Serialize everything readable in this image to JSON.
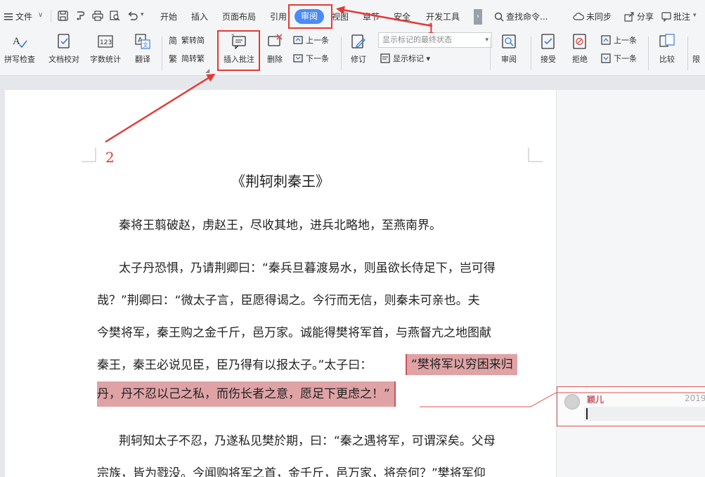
{
  "menubar": {
    "file_label": "文件",
    "tabs": [
      "开始",
      "插入",
      "页面布局",
      "引用",
      "审阅",
      "视图",
      "章节",
      "安全",
      "开发工具"
    ],
    "active_tab": "审阅",
    "search": "查找命令...",
    "sync": "未同步",
    "share": "分享",
    "comment": "批注"
  },
  "ribbon": {
    "spell_check": "拼写检查",
    "proofread": "文档校对",
    "word_count": "字数统计",
    "translate": "翻译",
    "trad_to_simp": "繁转简",
    "simp_to_trad": "简转繁",
    "insert_comment": "插入批注",
    "delete": "删除",
    "prev_comment": "上一条",
    "next_comment": "下一条",
    "revise": "修订",
    "markup_state": "显示标记的最终状态",
    "show_markup": "显示标记",
    "review": "审阅",
    "accept": "接受",
    "reject": "拒绝",
    "prev_change": "上一条",
    "next_change": "下一条",
    "compare": "比较",
    "restrict": "限"
  },
  "document": {
    "title": "《荆轲刺秦王》",
    "lines": [
      "秦将王翦破赵，虏赵王，尽收其地，进兵北略地，至燕南界。",
      "太子丹恐惧，乃请荆卿曰：“秦兵旦暮渡易水，则虽欲长侍足下，岂可得",
      "哉？”荆卿曰：“微太子言，臣愿得谒之。今行而无信，则秦未可亲也。夫",
      "今樊将军，秦王购之金千斤，邑万家。诚能得樊将军首，与燕督亢之地图献",
      "秦王，秦王必说见臣，臣乃得有以报太子。”太子曰：",
      "“樊将军以穷困来归",
      "丹，丹不忍以己之私，而伤长者之意，愿足下更虑之！”",
      "荆轲知太子不忍，乃遂私见樊於期，曰：“秦之遇将军，可谓深矣。父母",
      "宗族，皆为戮没。今闻购将军之首，金千斤，邑万家，将奈何？”樊将军仰"
    ]
  },
  "comment": {
    "author": "颖儿",
    "date": "2019"
  },
  "annotations": {
    "label_1": "1",
    "label_2": "2",
    "color": "#e53935"
  },
  "colors": {
    "accent": "#4a8cf7",
    "highlight": "#dfa3a6",
    "comment_author": "#c45460"
  }
}
